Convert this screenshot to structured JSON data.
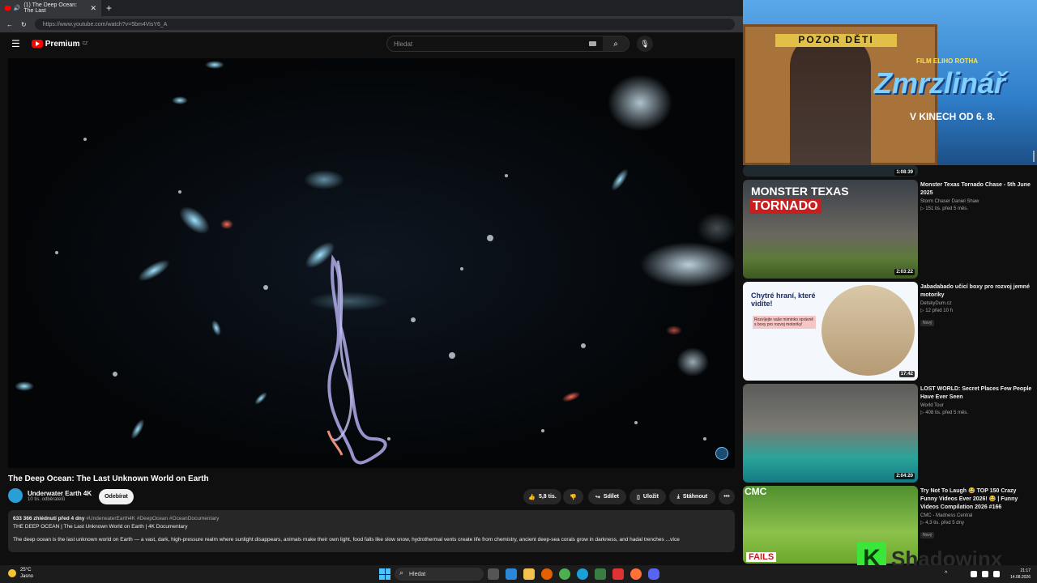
{
  "browser": {
    "tab_title": "(1) The Deep Ocean: The Last",
    "url": "https://www.youtube.com/watch?v=5bm4VisY6_A"
  },
  "header": {
    "logo_text": "Premium",
    "region": "CZ",
    "search_placeholder": "Hledat"
  },
  "video": {
    "title": "The Deep Ocean: The Last Unknown World on Earth",
    "channel": "Underwater Earth 4K",
    "subscribers": "10 tis. odběratelů",
    "subscribe_label": "Odebírat",
    "likes": "5,8 tis.",
    "share_label": "Sdílet",
    "save_label": "Uložit",
    "download_label": "Stáhnout",
    "more_label": "•••",
    "stats": "633 366 zhlédnutí  před 4 dny",
    "tags": "#UnderwaterEarth4K #DeepOcean #OceanDocumentary",
    "desc_heading": "THE DEEP OCEAN | The Last Unknown World on Earth | 4K Documentary",
    "desc_text": "The deep ocean is the last unknown world on Earth — a vast, dark, high-pressure realm where sunlight disappears, animals make their own light, food falls like slow snow, hydrothermal vents create life from chemistry, ancient deep-sea corals grow in darkness, and hadal trenches ...více"
  },
  "ad": {
    "sign": "POZOR DĚTI",
    "pre": "FILM ELIHO ROTHA",
    "title": "Zmrzlinář",
    "date": "V KINECH OD 6. 8."
  },
  "recommended": [
    {
      "title": "",
      "channel": "",
      "stats": "",
      "duration": "1:08:39",
      "badge": ""
    },
    {
      "title": "Monster Texas Tornado Chase - 5th June 2025",
      "channel": "Storm Chaser Daniel Shaw",
      "stats": "▷ 151 tis.  před 5 měs.",
      "duration": "2:03:22",
      "badge": "",
      "thumb_text1": "MONSTER TEXAS",
      "thumb_text2": "TORNADO"
    },
    {
      "title": "Jabadabado učicí boxy pro rozvoj jemné motoriky",
      "channel": "DetskyDum.cz",
      "stats": "▷ 12  před 10 h",
      "duration": "17:42",
      "badge": "Nový",
      "thumb_text1": "Chytré hraní, které vidíte!",
      "thumb_text2": "Rozvíjejte vaše miminko správně s boxy pro rozvoj motoriky!"
    },
    {
      "title": "LOST WORLD: Secret Places Few People Have Ever Seen",
      "channel": "World Tour",
      "stats": "▷ 408 tis.  před 5 měs.",
      "duration": "2:04:20",
      "badge": ""
    },
    {
      "title": "Try Not To Laugh 😂 TOP 150 Crazy Funny Videos Ever 2026! 😂 | Funny Videos Compilation 2026 #166",
      "channel": "CMC - Madness Central",
      "stats": "▷ 4,3 tis.  před 5 dny",
      "duration": "",
      "badge": "Nový",
      "thumb_text1": "CMC",
      "thumb_text2": "FAILS"
    }
  ],
  "taskbar": {
    "temp": "25°C",
    "weather": "Jasno",
    "search": "Hledat",
    "time": "21:17",
    "date": "14.08.2026"
  },
  "watermark": {
    "text": "Shadowinx"
  }
}
